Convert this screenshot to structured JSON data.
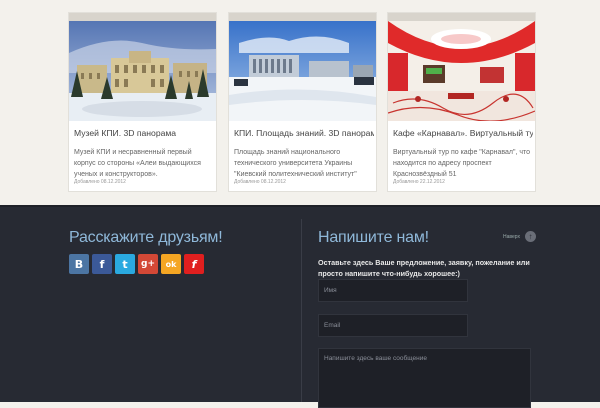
{
  "cards": [
    {
      "title": "Музей КПИ. 3D панорама",
      "description": "Музей КПИ и несравненный первый корпус со стороны «Алеи выдающихся ученых и конструкторов».",
      "date": "Добавлено 08.12.2012"
    },
    {
      "title": "КПИ. Площадь знаний. 3D панорама",
      "description": "Площадь знаний национального технического университета Украины \"Киевский политехнический институт\"",
      "date": "Добавлено 08.12.2012"
    },
    {
      "title": "Кафе «Карнавал». Виртуальный тур",
      "description": "Виртуальный тур по кафе \"Карнавал\", что находится по адресу проспект Краснозвёздный 51",
      "date": "Добавлено 22.12.2012"
    }
  ],
  "share": {
    "title": "Расскажите друзьям!",
    "buttons": [
      {
        "label": "B",
        "name": "vkontakte",
        "color": "#4c75a3"
      },
      {
        "label": "f",
        "name": "facebook",
        "color": "#3b5998"
      },
      {
        "label": "t",
        "name": "twitter",
        "color": "#2aa9e0"
      },
      {
        "label": "g+",
        "name": "google-plus",
        "color": "#d34836"
      },
      {
        "label": "ok",
        "name": "odnoklassniki",
        "color": "#f5a623"
      },
      {
        "label": "f",
        "name": "fotostrana",
        "color": "#e01f1f"
      }
    ]
  },
  "contact": {
    "title": "Напишите нам!",
    "nav_label": "Наверх",
    "intro": "Оставьте здесь Ваше предложение, заявку, пожелание или просто напишите что-нибудь хорошее:)",
    "name_placeholder": "Имя",
    "email_placeholder": "Email",
    "message_placeholder": "Напишите здесь ваше сообщение"
  }
}
